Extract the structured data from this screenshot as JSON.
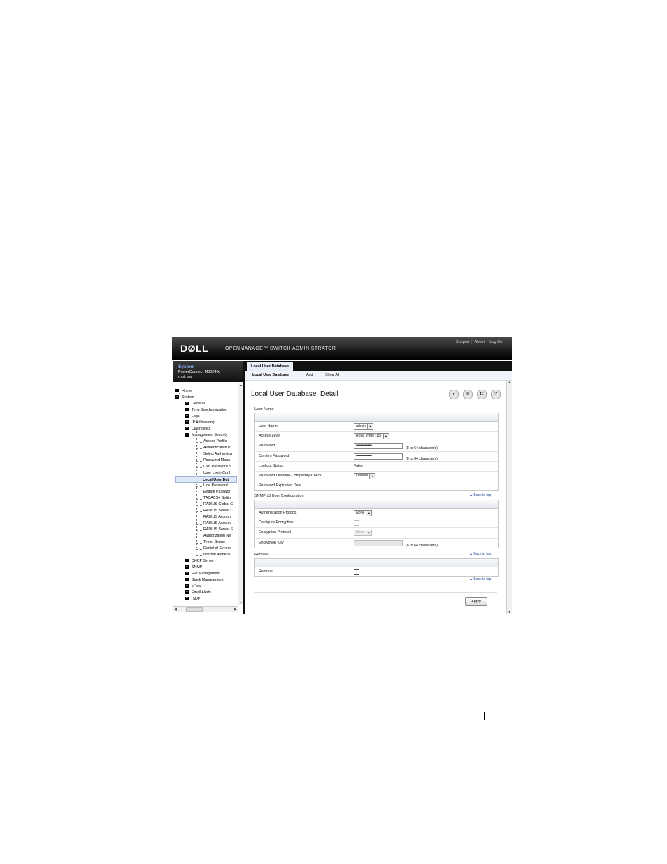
{
  "header": {
    "logo": "DØLL",
    "app_title": "OPENMANAGE™ SWITCH ADMINISTRATOR",
    "links": [
      "Support",
      "About",
      "Log Out"
    ]
  },
  "system_box": {
    "title": "System",
    "device": "PowerConnect M8024-k",
    "user": "root, r/w"
  },
  "tree": {
    "top": [
      "Home",
      "System"
    ],
    "system_children": [
      "General",
      "Time Synchronization",
      "Logs",
      "IP Addressing",
      "Diagnostics",
      "Management Security"
    ],
    "mgmt_children": [
      "Access Profile",
      "Authentication P",
      "Select Authentica",
      "Password Mana",
      "Last Password S",
      "User Login Conf",
      "Local User Dat",
      "Line Password",
      "Enable Passwor",
      "TACACS+ Settin",
      "RADIUS Global C",
      "RADIUS Server C",
      "RADIUS Accoun",
      "RADIUS Accoun",
      "RADIUS Server S",
      "Authorization Ne",
      "Telnet Server",
      "Denial of Service",
      "Internal Authenti"
    ],
    "bottom": [
      "DHCP Server",
      "SNMP",
      "File Management",
      "Stack Management",
      "sFlow",
      "Email Alerts",
      "ISDP"
    ]
  },
  "tabs": {
    "main_tab": "Local User Database",
    "sub": [
      "Local User Database",
      "Add",
      "Show All"
    ]
  },
  "page_title": "Local User Database: Detail",
  "toolbar": [
    "save-icon",
    "print-icon",
    "refresh-icon",
    "help-icon"
  ],
  "sections": {
    "user_name": {
      "title": "User Name",
      "rows": {
        "user_name_label": "User Name",
        "user_name_value": "admin",
        "access_level_label": "Access Level",
        "access_level_value": "Read Write (15)",
        "password_label": "Password",
        "password_value": "••••••••••••••••••",
        "password_hint": "(8 to 64 characters)",
        "confirm_label": "Confirm Password",
        "confirm_value": "••••••••••••••••••",
        "confirm_hint": "(8 to 64 characters)",
        "lockout_label": "Lockout Status",
        "lockout_value": "False",
        "override_label": "Password Override-Complexity-Check",
        "override_value": "Disable",
        "expiration_label": "Password Expiration Date"
      }
    },
    "snmp": {
      "title": "SNMP v3 User Configuration",
      "back": "Back to top",
      "rows": {
        "auth_label": "Authentication Protocol",
        "auth_value": "None",
        "configure_enc_label": "Configure Encryption",
        "enc_protocol_label": "Encryption Protocol",
        "enc_protocol_value": "None",
        "enc_key_label": "Encryption Key",
        "enc_key_hint": "(8 to 64 characters)"
      }
    },
    "remove": {
      "title": "Remove",
      "back": "Back to top",
      "remove_label": "Remove",
      "back_bottom": "Back to top"
    }
  },
  "apply_label": "Apply"
}
